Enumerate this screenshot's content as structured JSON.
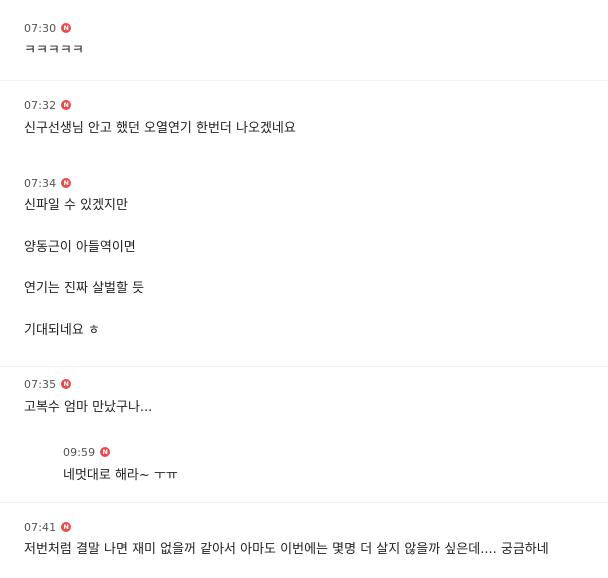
{
  "badge_letter": "N",
  "badge_color": "#e94b4b",
  "comments": [
    {
      "time": "07:30",
      "lines": [
        "ㅋㅋㅋㅋㅋ"
      ]
    },
    {
      "time": "07:32",
      "lines": [
        "신구선생님 안고 했던 오열연기 한번더 나오겠네요"
      ]
    },
    {
      "time": "07:34",
      "lines": [
        "신파일 수 있겠지만",
        "양동근이 아들역이면",
        "연기는 진짜 살벌할 듯",
        "기대되네요 ㅎ"
      ]
    },
    {
      "time": "07:35",
      "lines": [
        "고복수 엄마 만났구나..."
      ],
      "reply": {
        "time": "09:59",
        "lines": [
          "네멋대로 해라~ ㅜㅠ"
        ]
      }
    },
    {
      "time": "07:41",
      "lines": [
        "저번처럼 결말 나면 재미 없을꺼 같아서 아마도 이번에는 몇명 더 살지 않을까 싶은데.... 궁금하네"
      ]
    }
  ]
}
